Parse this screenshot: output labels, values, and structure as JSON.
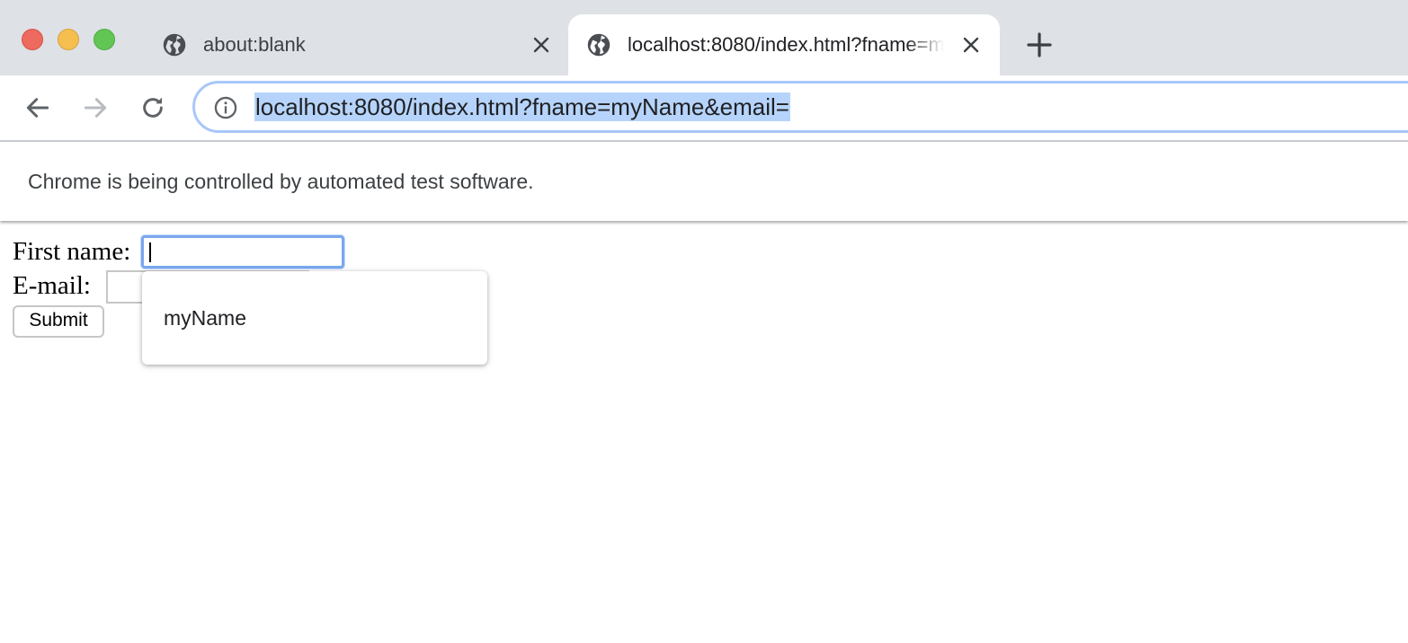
{
  "browser": {
    "tabs": [
      {
        "title": "about:blank",
        "active": false
      },
      {
        "title": "localhost:8080/index.html?fname=myName&email=",
        "active": true
      }
    ],
    "address_bar": {
      "url": "localhost:8080/index.html?fname=myName&email="
    },
    "infobar": {
      "message": "Chrome is being controlled by automated test software."
    },
    "icons": {
      "tab_icon": "globe-icon",
      "tab_close": "close-icon",
      "new_tab": "plus-icon",
      "back": "arrow-left-icon",
      "forward": "arrow-right-icon",
      "reload": "reload-icon",
      "site_info": "info-icon"
    },
    "colors": {
      "tabstrip_bg": "#dee1e6",
      "omnibox_focus": "#a8c7fa",
      "url_selection": "#b6d4fb",
      "traffic_red": "#ee6a5f",
      "traffic_yellow": "#f5bf4f",
      "traffic_green": "#62c655"
    }
  },
  "form": {
    "first_name_label": "First name:",
    "first_name_value": "",
    "email_label": "E-mail:",
    "email_value": "",
    "submit_label": "Submit"
  },
  "autofill": {
    "suggestions": [
      "myName"
    ]
  }
}
